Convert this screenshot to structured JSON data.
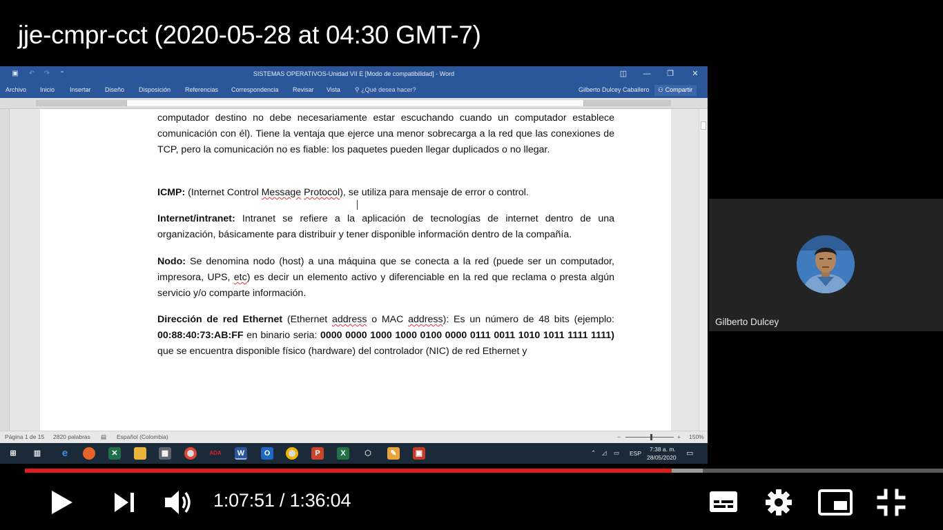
{
  "video": {
    "title": "jje-cmpr-cct (2020-05-28 at 04:30 GMT-7)"
  },
  "word": {
    "window_title": "SISTEMAS OPERATIVOS-Unidad VII E [Modo de compatibilidad] - Word",
    "ribbon_tabs": [
      "Archivo",
      "Inicio",
      "Insertar",
      "Diseño",
      "Disposición",
      "Referencias",
      "Correspondencia",
      "Revisar",
      "Vista"
    ],
    "tell_me": "¿Qué desea hacer?",
    "user": "Gilberto Dulcey Caballero",
    "share": "Compartir",
    "document": {
      "p1": "computador destino no debe necesariamente estar escuchando cuando un computador establece comunicación con él). Tiene la ventaja que ejerce una menor sobrecarga a la red que las conexiones de TCP, pero la comunicación no es fiable: los paquetes pueden llegar duplicados o no llegar.",
      "icmp_term": "ICMP:",
      "icmp_a": " (Internet Control ",
      "icmp_b": "Message",
      "icmp_c": " ",
      "icmp_d": "Protocol",
      "icmp_e": "), se utiliza para mensaje de error o control.",
      "intranet_term": "Internet/intranet:",
      "intranet_text": " Intranet se refiere a la aplicación de tecnologías de internet dentro de una organización, básicamente para distribuir y tener disponible información dentro de la compañía.",
      "nodo_term": "Nodo:",
      "nodo_text": " Se denomina nodo (host) a una máquina que se conecta a la red (puede ser un computador, impresora, UPS, ",
      "nodo_etc": "etc",
      "nodo_text2": ") es decir un elemento activo y diferenciable en la red que reclama o presta algún servicio y/o comparte información.",
      "eth_term": "Dirección de red Ethernet",
      "eth_a": " (Ethernet ",
      "eth_b": "address",
      "eth_c": " o MAC ",
      "eth_d": "address",
      "eth_e": "): Es un número de 48 bits (ejemplo: ",
      "eth_mac": "00:88:40:73:AB:FF",
      "eth_f": "  en binario seria: ",
      "eth_bin": "0000 0000 1000 1000 0100 0000 0111 0011 1010 1011 1111 1111)",
      "eth_g": "  que se encuentra disponible físico (hardware) del controlador (NIC) de red Ethernet y"
    },
    "status": {
      "page": "Página 1 de 15",
      "words": "2820 palabras",
      "language": "Español (Colombia)",
      "zoom": "150%"
    }
  },
  "taskbar": {
    "icons": [
      "windows-start",
      "task-view",
      "edge",
      "firefox",
      "excel-green",
      "file-explorer",
      "calculator",
      "chrome",
      "acrobat",
      "word",
      "outlook",
      "chrome-2",
      "powerpoint",
      "excel",
      "3d-viewer",
      "paint-tool",
      "presentation-app"
    ],
    "language": "ESP",
    "time": "7:38 a. m.",
    "date": "28/05/2020"
  },
  "participant": {
    "name": "Gilberto Dulcey"
  },
  "player": {
    "current_time": "1:07:51",
    "separator": " / ",
    "duration": "1:36:04",
    "progress_fraction": 0.7047,
    "buffered_fraction": 0.7386,
    "progress_color": "#e01b1b"
  }
}
